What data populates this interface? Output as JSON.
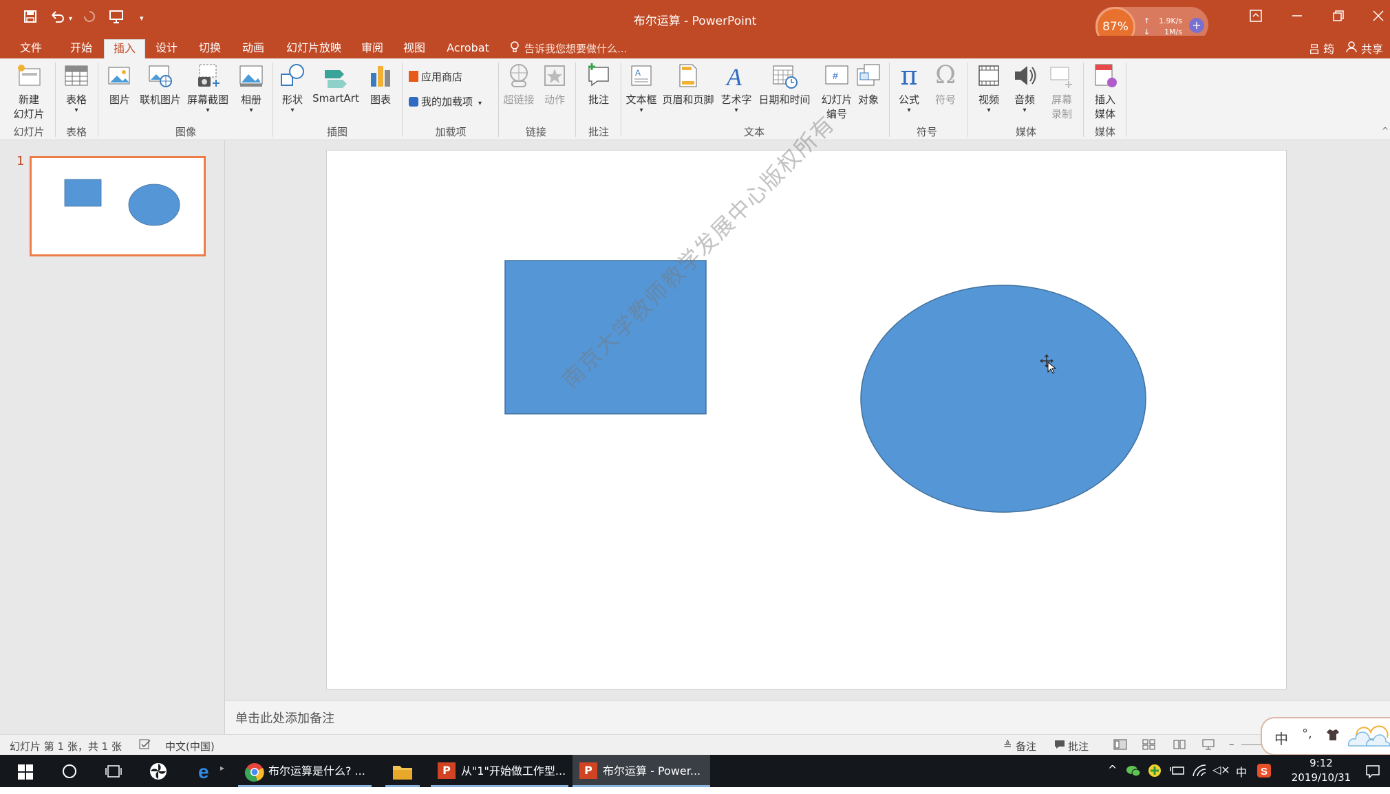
{
  "window": {
    "title": "布尔运算 - PowerPoint",
    "user": "吕 筠",
    "share": "共享"
  },
  "net_widget": {
    "percent": "87%",
    "up": "1.9K/s",
    "down": "1M/s",
    "up_arrow": "↑",
    "down_arrow": "↓"
  },
  "tabs": [
    "文件",
    "开始",
    "插入",
    "设计",
    "切换",
    "动画",
    "幻灯片放映",
    "审阅",
    "视图",
    "Acrobat"
  ],
  "active_tab": "插入",
  "tell_me": "告诉我您想要做什么...",
  "ribbon": {
    "new_slide_1": "新建",
    "new_slide_2": "幻灯片",
    "table": "表格",
    "picture": "图片",
    "online_picture": "联机图片",
    "screenshot": "屏幕截图",
    "album": "相册",
    "shapes": "形状",
    "smartart": "SmartArt",
    "chart": "图表",
    "store": "应用商店",
    "my_addins": "我的加载项",
    "hyperlink": "超链接",
    "action": "动作",
    "comment": "批注",
    "textbox": "文本框",
    "header_footer": "页眉和页脚",
    "wordart": "艺术字",
    "datetime": "日期和时间",
    "slide_number_1": "幻灯片",
    "slide_number_2": "编号",
    "object": "对象",
    "equation": "公式",
    "symbol": "符号",
    "video": "视频",
    "audio": "音频",
    "screen_rec_1": "屏幕",
    "screen_rec_2": "录制",
    "insert_media_1": "插入",
    "insert_media_2": "媒体",
    "groups": {
      "slides": "幻灯片",
      "tables": "表格",
      "images": "图像",
      "illustrations": "插图",
      "addins": "加载项",
      "links": "链接",
      "comments": "批注",
      "text": "文本",
      "symbols": "符号",
      "media": "媒体",
      "media2": "媒体"
    }
  },
  "slide_panel": {
    "number": "1"
  },
  "slide": {
    "watermark": "南京大学教师教学发展中心版权所有",
    "shape_color": "#5596d6",
    "shape_border": "#41719c"
  },
  "notes_placeholder": "单击此处添加备注",
  "statusbar": {
    "slide_info": "幻灯片 第 1 张，共 1 张",
    "language": "中文(中国)",
    "notes": "备注",
    "comments": "批注",
    "ime_1": "中",
    "ime_2": "°,"
  },
  "taskbar": {
    "app1": "布尔运算是什么? ...",
    "app2": "从\"1\"开始做工作型...",
    "app3": "布尔运算 - Power...",
    "ime": "中",
    "time": "9:12",
    "date": "2019/10/31"
  },
  "colors": {
    "accent": "#c04a26",
    "selected_border": "#ee7c48"
  }
}
